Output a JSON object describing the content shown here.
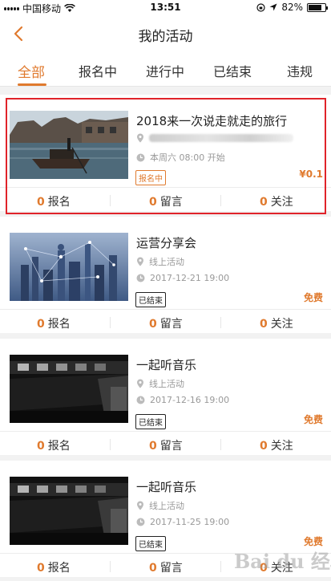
{
  "status_bar": {
    "carrier": "中国移动",
    "time": "13:51",
    "battery": "82%",
    "battery_level": 0.82
  },
  "nav": {
    "title": "我的活动"
  },
  "tabs": [
    {
      "label": "全部",
      "active": true
    },
    {
      "label": "报名中",
      "active": false
    },
    {
      "label": "进行中",
      "active": false
    },
    {
      "label": "已结束",
      "active": false
    },
    {
      "label": "违规",
      "active": false
    }
  ],
  "activities": [
    {
      "title": "2018来一次说走就走的旅行",
      "location": "",
      "time": "本周六 08:00 开始",
      "status": "报名中",
      "price": "¥0.1",
      "signups": "0",
      "signups_label": "报名",
      "comments": "0",
      "comments_label": "留言",
      "follows": "0",
      "follows_label": "关注"
    },
    {
      "title": "运营分享会",
      "location": "线上活动",
      "time": "2017-12-21 19:00",
      "status": "已结束",
      "price": "免费",
      "signups": "0",
      "signups_label": "报名",
      "comments": "0",
      "comments_label": "留言",
      "follows": "0",
      "follows_label": "关注"
    },
    {
      "title": "一起听音乐",
      "location": "线上活动",
      "time": "2017-12-16 19:00",
      "status": "已结束",
      "price": "免费",
      "signups": "0",
      "signups_label": "报名",
      "comments": "0",
      "comments_label": "留言",
      "follows": "0",
      "follows_label": "关注"
    },
    {
      "title": "一起听音乐",
      "location": "线上活动",
      "time": "2017-11-25 19:00",
      "status": "已结束",
      "price": "免费",
      "signups": "0",
      "signups_label": "报名",
      "comments": "0",
      "comments_label": "留言",
      "follows": "0",
      "follows_label": "关注"
    }
  ],
  "watermark": "Bai du 经验",
  "colors": {
    "accent": "#e07a2e",
    "highlight": "#e0232a"
  }
}
